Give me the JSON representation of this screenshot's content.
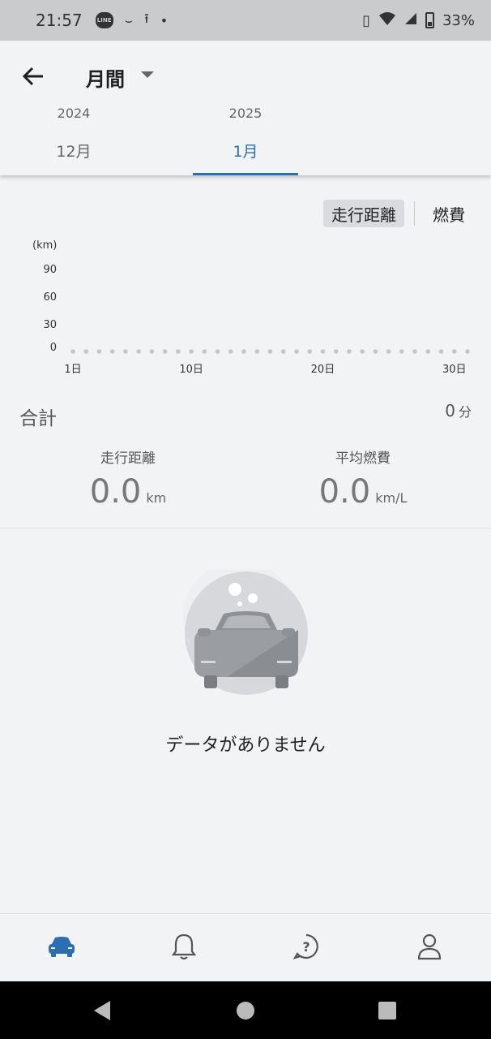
{
  "status_bar": {
    "time": "21:57",
    "line_icon_text": "LINE",
    "battery": "33%"
  },
  "header": {
    "title": "月間",
    "tabs": [
      {
        "year": "2024",
        "month": "12月"
      },
      {
        "year": "2025",
        "month": "1月"
      }
    ]
  },
  "chart_toggle": {
    "distance": "走行距離",
    "fuel": "燃費"
  },
  "chart_data": {
    "type": "scatter",
    "ylabel": "(km)",
    "y_ticks": [
      "90",
      "60",
      "30",
      "0"
    ],
    "ylim": [
      0,
      90
    ],
    "x_ticks": [
      "1日",
      "10日",
      "20日",
      "30日"
    ],
    "x": [
      1,
      2,
      3,
      4,
      5,
      6,
      7,
      8,
      9,
      10,
      11,
      12,
      13,
      14,
      15,
      16,
      17,
      18,
      19,
      20,
      21,
      22,
      23,
      24,
      25,
      26,
      27,
      28,
      29,
      30,
      31
    ],
    "values": [
      0,
      0,
      0,
      0,
      0,
      0,
      0,
      0,
      0,
      0,
      0,
      0,
      0,
      0,
      0,
      0,
      0,
      0,
      0,
      0,
      0,
      0,
      0,
      0,
      0,
      0,
      0,
      0,
      0,
      0,
      0
    ]
  },
  "summary": {
    "total_label": "合計",
    "total_value": "0",
    "total_unit": "分",
    "distance_label": "走行距離",
    "distance_value": "0.0",
    "distance_unit": "km",
    "fuel_label": "平均燃費",
    "fuel_value": "0.0",
    "fuel_unit": "km/L"
  },
  "empty_state": {
    "message": "データがありません"
  },
  "colors": {
    "accent": "#2c6fb1",
    "background": "#f2f3f5"
  }
}
